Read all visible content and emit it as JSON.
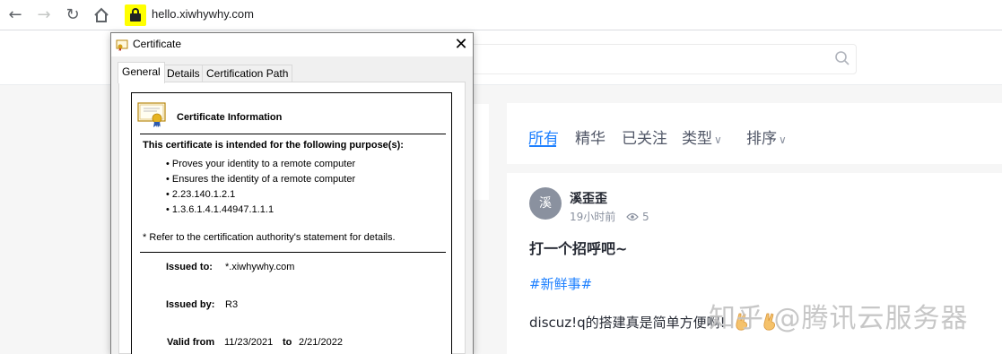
{
  "browser": {
    "back_icon": "arrow-left-icon",
    "forward_icon": "arrow-right-icon",
    "reload_icon": "reload-icon",
    "home_icon": "home-icon",
    "lock_icon": "lock-icon",
    "lock_highlight": "#ffff00",
    "url": "hello.xiwhywhy.com"
  },
  "dialog": {
    "title": "Certificate",
    "tabs": [
      "General",
      "Details",
      "Certification Path"
    ],
    "active_tab": "General",
    "info_title": "Certificate Information",
    "purpose_title": "This certificate is intended for the following purpose(s):",
    "purposes": [
      "• Proves your identity to a remote computer",
      "• Ensures the identity of a remote computer",
      "• 2.23.140.1.2.1",
      "• 1.3.6.1.4.1.44947.1.1.1"
    ],
    "refer_note": "* Refer to the certification authority's statement for details.",
    "issued_to_label": "Issued to:",
    "issued_to": "*.xiwhywhy.com",
    "issued_by_label": "Issued by:",
    "issued_by": "R3",
    "valid_from_label": "Valid from",
    "valid_from": "11/23/2021",
    "valid_to_label": "to",
    "valid_to": "2/21/2022"
  },
  "page": {
    "tabs": [
      "所有",
      "精华",
      "已关注",
      "类型",
      "排序"
    ],
    "active_tab": "所有",
    "accent": "#1e80ff",
    "post": {
      "avatar_text": "溪",
      "author": "溪歪歪",
      "time": "19小时前",
      "views": "5",
      "title": "打一个招呼吧~",
      "tag": "#新鲜事#",
      "body": "discuz!q的搭建真是简单方便啊!"
    },
    "watermark": "知乎 @腾讯云服务器"
  }
}
